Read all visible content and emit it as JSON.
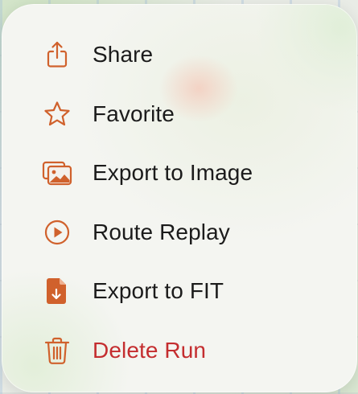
{
  "menu": {
    "items": [
      {
        "label": "Share",
        "icon": "share-icon"
      },
      {
        "label": "Favorite",
        "icon": "star-icon"
      },
      {
        "label": "Export to Image",
        "icon": "image-icon"
      },
      {
        "label": "Route Replay",
        "icon": "play-circle-icon"
      },
      {
        "label": "Export to FIT",
        "icon": "download-document-icon"
      },
      {
        "label": "Delete Run",
        "icon": "trash-icon"
      }
    ]
  },
  "colors": {
    "accent": "#d0612c",
    "destructive": "#c42d2f",
    "text": "#1b1b1b",
    "menu_background": "#f4f5f1"
  }
}
